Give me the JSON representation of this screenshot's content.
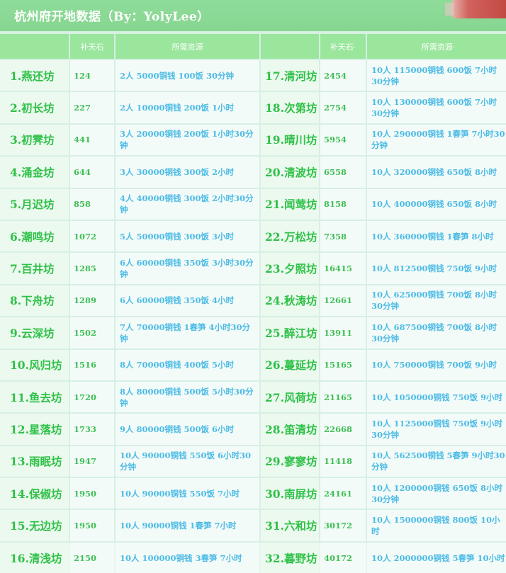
{
  "title": "杭州府开地数据（By：YolyLee）",
  "headers": {
    "left": [
      "",
      "补天石",
      "所需资源"
    ],
    "right": [
      "",
      "补天石·",
      "所需资源·"
    ]
  },
  "left_rows": [
    {
      "name": "1.燕还坊",
      "price": "124",
      "res": "2人 5000铜钱 100饭 30分钟"
    },
    {
      "name": "2.初长坊",
      "price": "227",
      "res": "2人 10000铜钱 200饭 1小时"
    },
    {
      "name": "3.初霁坊",
      "price": "441",
      "res": "3人 20000铜钱 200饭 1小时30分钟"
    },
    {
      "name": "4.涌金坊",
      "price": "644",
      "res": "3人 30000铜钱 300饭 2小时"
    },
    {
      "name": "5.月迟坊",
      "price": "858",
      "res": "4人 40000铜钱 300饭 2小时30分钟"
    },
    {
      "name": "6.潮鸣坊",
      "price": "1072",
      "res": "5人 50000铜钱 300饭 3小时"
    },
    {
      "name": "7.百井坊",
      "price": "1285",
      "res": "6人 60000铜钱 350饭 3小时30分钟"
    },
    {
      "name": "8.下舟坊",
      "price": "1289",
      "res": "6人 60000铜钱 350饭 4小时"
    },
    {
      "name": "9.云深坊",
      "price": "1502",
      "res": "7人 70000铜钱 1春笋 4小时30分钟"
    },
    {
      "name": "10.风归坊",
      "price": "1516",
      "res": "8人 70000铜钱 400饭 5小时"
    },
    {
      "name": "11.鱼去坊",
      "price": "1720",
      "res": "8人 80000铜钱 500饭 5小时30分钟"
    },
    {
      "name": "12.星落坊",
      "price": "1733",
      "res": "9人 80000铜钱 500饭 6小时"
    },
    {
      "name": "13.雨眠坊",
      "price": "1947",
      "res": "10人 90000铜钱 550饭 6小时30分钟"
    },
    {
      "name": "14.保俶坊",
      "price": "1950",
      "res": "10人 90000铜钱 550饭 7小时"
    },
    {
      "name": "15.无边坊",
      "price": "1950",
      "res": "10人 90000铜钱 1春笋 7小时"
    },
    {
      "name": "16.清浅坊",
      "price": "2150",
      "res": "10人 100000铜钱 3春笋 7小时"
    }
  ],
  "right_rows": [
    {
      "name": "17.清河坊",
      "price": "2454",
      "res": "10人 115000铜钱 600饭 7小时30分钟"
    },
    {
      "name": "18.次第坊",
      "price": "2754",
      "res": "10人 130000铜钱 600饭 7小时30分钟"
    },
    {
      "name": "19.晴川坊",
      "price": "5954",
      "res": "10人 290000铜钱 1春笋 7小时30分钟"
    },
    {
      "name": "20.清波坊",
      "price": "6558",
      "res": "10人 320000铜钱 650饭 8小时"
    },
    {
      "name": "21.闻莺坊",
      "price": "8158",
      "res": "10人 400000铜钱 650饭 8小时"
    },
    {
      "name": "22.万松坊",
      "price": "7358",
      "res": "10人 360000铜钱 1春笋 8小时"
    },
    {
      "name": "23.夕照坊",
      "price": "16415",
      "res": "10人 812500铜钱 750饭 9小时"
    },
    {
      "name": "24.秋涛坊",
      "price": "12661",
      "res": "10人 625000铜钱 700饭 8小时30分钟"
    },
    {
      "name": "25.醉江坊",
      "price": "13911",
      "res": "10人 687500铜钱 700饭 8小时30分钟"
    },
    {
      "name": "26.蔓延坊",
      "price": "15165",
      "res": "10人 750000铜钱 700饭 9小时"
    },
    {
      "name": "27.风荷坊",
      "price": "21165",
      "res": "10人 1050000铜钱 750饭 9小时"
    },
    {
      "name": "28.笛清坊",
      "price": "22668",
      "res": "10人 1125000铜钱 750饭 9小时30分钟"
    },
    {
      "name": "29.寥寥坊",
      "price": "11418",
      "res": "10人 562500铜钱 5春笋 9小时30分钟"
    },
    {
      "name": "30.南屏坊",
      "price": "24161",
      "res": "10人 1200000铜钱 650饭 8小时30分钟"
    },
    {
      "name": "31.六和坊",
      "price": "30172",
      "res": "10人 1500000铜钱 800饭 10小时"
    },
    {
      "name": "32.暮野坊",
      "price": "40172",
      "res": "10人 2000000铜钱 5春笋 10小时"
    }
  ]
}
